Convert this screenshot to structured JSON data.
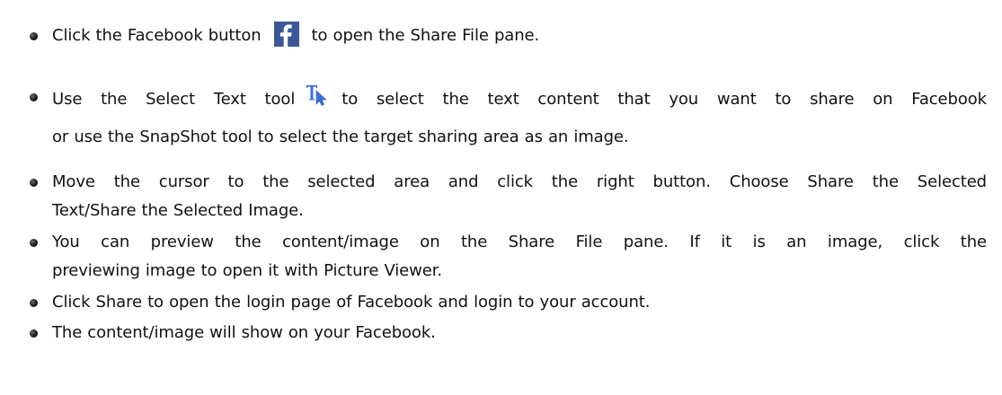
{
  "steps": [
    {
      "before_icon": "Click the Facebook button",
      "icon": "facebook-icon",
      "after_icon": "to open the Share File pane."
    },
    {
      "before_icon": "Use the Select Text tool",
      "icon": "select-text-tool-icon",
      "after_icon": "to select the text content that you want to share on Facebook",
      "line2": "or use the SnapShot tool to select the target sharing area as an image."
    },
    {
      "line1": "Move the cursor to the selected area and click the right button. Choose Share the Selected",
      "line2": "Text/Share the Selected Image."
    },
    {
      "line1": "You can preview the content/image on the Share File pane. If it is an image, click the",
      "line2": "previewing image to open it with Picture Viewer."
    },
    {
      "line1": "Click Share to open the login page of Facebook and login to your account."
    },
    {
      "line1": "The content/image will show on your Facebook."
    }
  ],
  "colors": {
    "facebook_blue": "#3b5998",
    "tool_icon_blue": "#3a6fd8",
    "bullet": "#1a1a1a"
  }
}
